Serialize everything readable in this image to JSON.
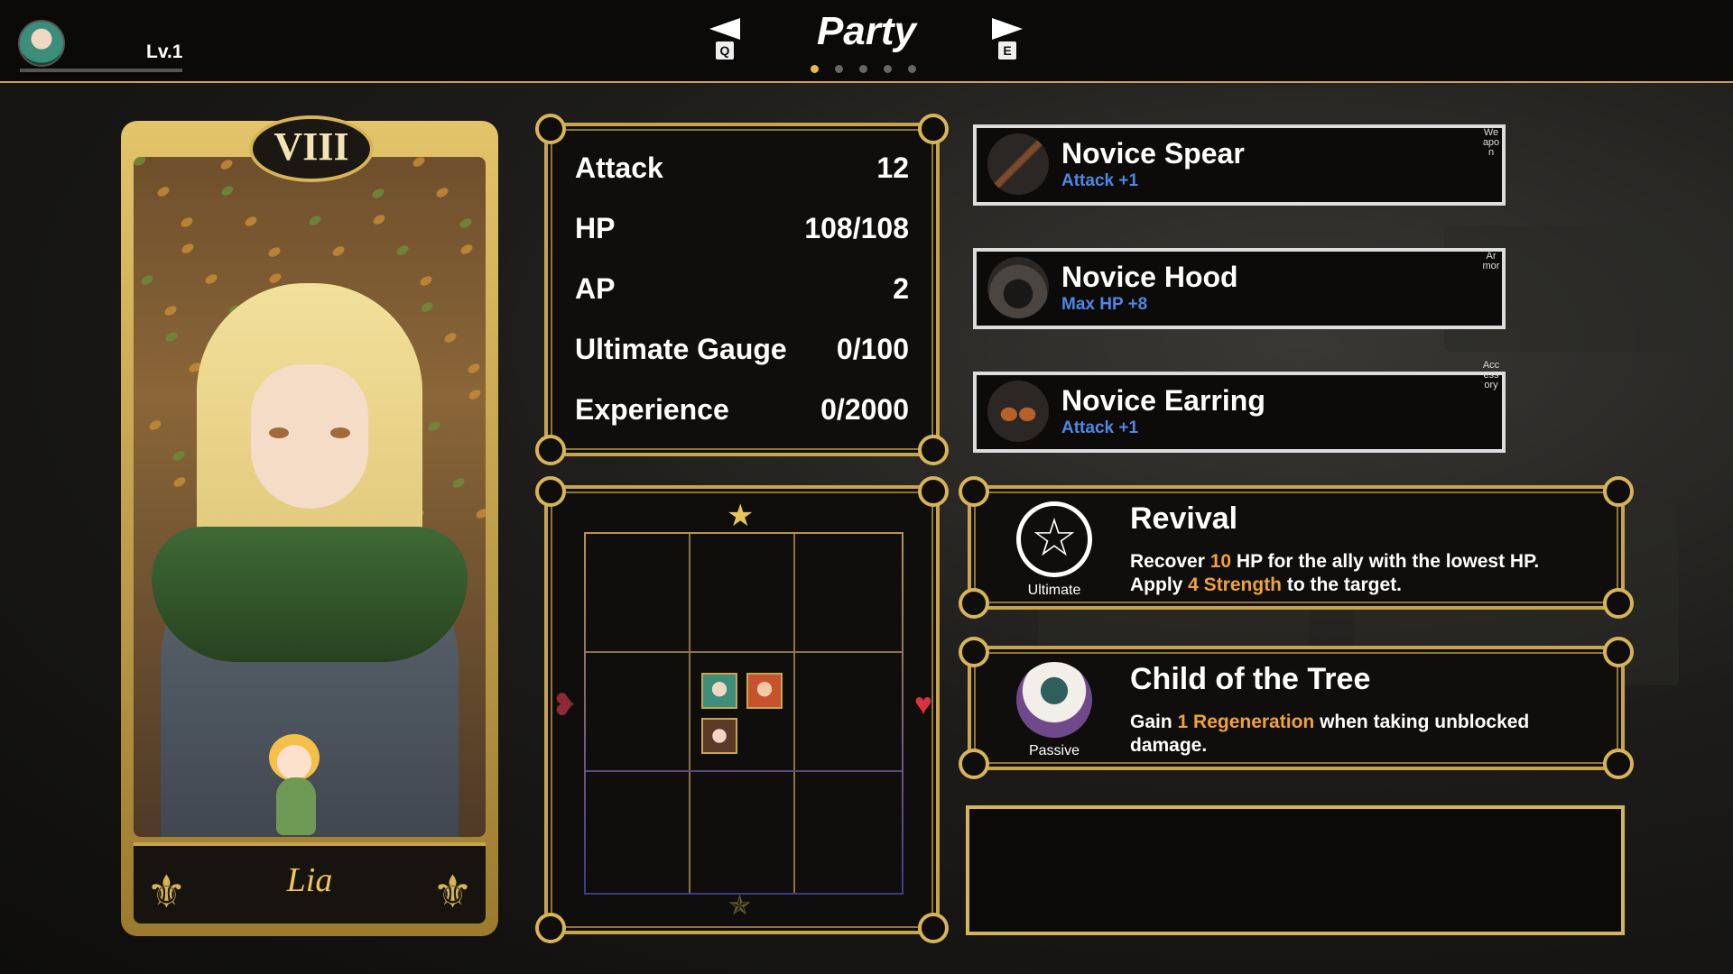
{
  "header": {
    "level": "Lv.1",
    "title": "Party",
    "prev_key": "Q",
    "next_key": "E",
    "page_count": 5,
    "active_page": 1
  },
  "character": {
    "numeral": "VIII",
    "name": "Lia"
  },
  "stats": [
    {
      "label": "Attack",
      "value": "12"
    },
    {
      "label": "HP",
      "value": "108/108"
    },
    {
      "label": "AP",
      "value": "2"
    },
    {
      "label": "Ultimate Gauge",
      "value": "0/100"
    },
    {
      "label": "Experience",
      "value": "0/2000"
    }
  ],
  "equipment": [
    {
      "name": "Novice Spear",
      "stat": "Attack +1",
      "slot": "Weapon",
      "icon": "spear-icon"
    },
    {
      "name": "Novice Hood",
      "stat": "Max HP +8",
      "slot": "Armor",
      "icon": "hood-icon"
    },
    {
      "name": "Novice Earring",
      "stat": "Attack +1",
      "slot": "Accessory",
      "icon": "earring-icon"
    }
  ],
  "skills": {
    "ultimate": {
      "type": "Ultimate",
      "name": "Revival",
      "line1_a": "Recover ",
      "line1_hl": "10",
      "line1_b": " HP for the ally with the lowest HP.",
      "line2_a": "Apply ",
      "line2_hl": "4 Strength",
      "line2_b": " to the target.",
      "icon": "pentagram-icon"
    },
    "passive": {
      "type": "Passive",
      "name": "Child of the Tree",
      "line1_a": "Gain ",
      "line1_hl": "1 Regeneration",
      "line1_b": " when taking unblocked damage.",
      "icon": "tree-icon"
    }
  },
  "colors": {
    "gold": "#c8a44a",
    "highlight": "#f0a23a",
    "equip_stat": "#4f86e6"
  }
}
